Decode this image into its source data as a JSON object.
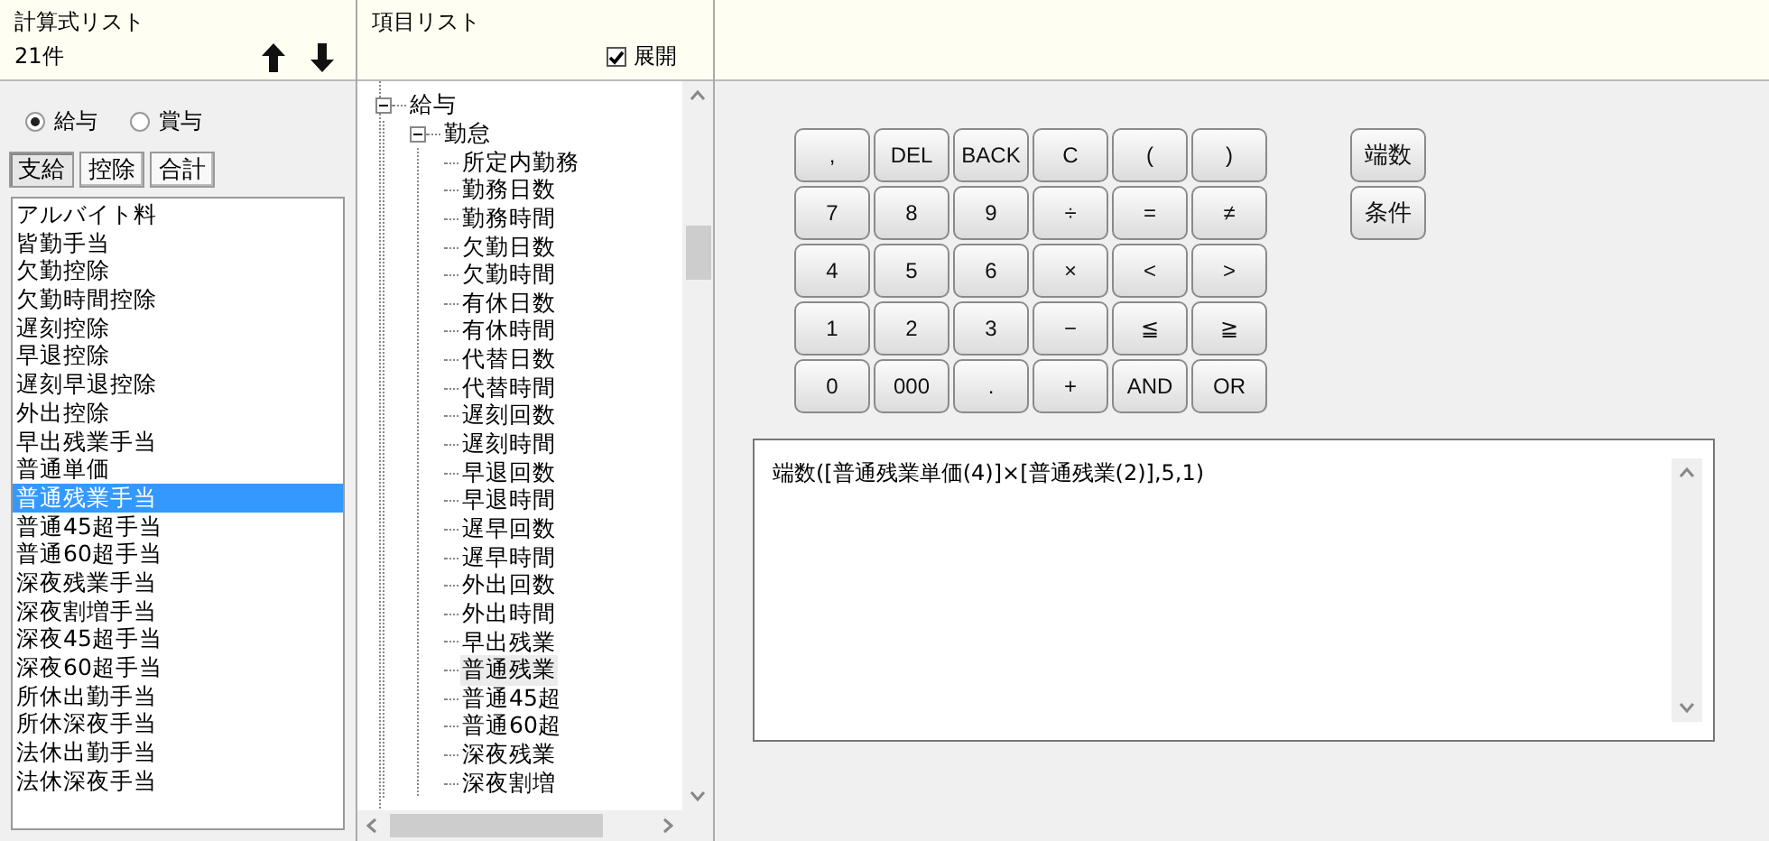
{
  "formula_list": {
    "title": "計算式リスト",
    "count": "21件",
    "radios": [
      {
        "label": "給与",
        "selected": true
      },
      {
        "label": "賞与",
        "selected": false
      }
    ],
    "tabs": [
      {
        "label": "支給",
        "selected": true
      },
      {
        "label": "控除",
        "selected": false
      },
      {
        "label": "合計",
        "selected": false
      }
    ],
    "items": [
      {
        "label": "アルバイト料",
        "selected": false
      },
      {
        "label": "皆勤手当",
        "selected": false
      },
      {
        "label": "欠勤控除",
        "selected": false
      },
      {
        "label": "欠勤時間控除",
        "selected": false
      },
      {
        "label": "遅刻控除",
        "selected": false
      },
      {
        "label": "早退控除",
        "selected": false
      },
      {
        "label": "遅刻早退控除",
        "selected": false
      },
      {
        "label": "外出控除",
        "selected": false
      },
      {
        "label": "早出残業手当",
        "selected": false
      },
      {
        "label": "普通単価",
        "selected": false
      },
      {
        "label": "普通残業手当",
        "selected": true
      },
      {
        "label": "普通45超手当",
        "selected": false
      },
      {
        "label": "普通60超手当",
        "selected": false
      },
      {
        "label": "深夜残業手当",
        "selected": false
      },
      {
        "label": "深夜割増手当",
        "selected": false
      },
      {
        "label": "深夜45超手当",
        "selected": false
      },
      {
        "label": "深夜60超手当",
        "selected": false
      },
      {
        "label": "所休出勤手当",
        "selected": false
      },
      {
        "label": "所休深夜手当",
        "selected": false
      },
      {
        "label": "法休出勤手当",
        "selected": false
      },
      {
        "label": "法休深夜手当",
        "selected": false
      }
    ]
  },
  "item_list": {
    "title": "項目リスト",
    "expand": {
      "label": "展開",
      "checked": true
    },
    "tree": [
      {
        "label": "給与",
        "expanded": true,
        "selected": false,
        "children": [
          {
            "label": "勤怠",
            "expanded": true,
            "selected": false,
            "children": [
              {
                "label": "所定内勤務",
                "selected": false
              },
              {
                "label": "勤務日数",
                "selected": false
              },
              {
                "label": "勤務時間",
                "selected": false
              },
              {
                "label": "欠勤日数",
                "selected": false
              },
              {
                "label": "欠勤時間",
                "selected": false
              },
              {
                "label": "有休日数",
                "selected": false
              },
              {
                "label": "有休時間",
                "selected": false
              },
              {
                "label": "代替日数",
                "selected": false
              },
              {
                "label": "代替時間",
                "selected": false
              },
              {
                "label": "遅刻回数",
                "selected": false
              },
              {
                "label": "遅刻時間",
                "selected": false
              },
              {
                "label": "早退回数",
                "selected": false
              },
              {
                "label": "早退時間",
                "selected": false
              },
              {
                "label": "遅早回数",
                "selected": false
              },
              {
                "label": "遅早時間",
                "selected": false
              },
              {
                "label": "外出回数",
                "selected": false
              },
              {
                "label": "外出時間",
                "selected": false
              },
              {
                "label": "早出残業",
                "selected": false
              },
              {
                "label": "普通残業",
                "selected": true
              },
              {
                "label": "普通45超",
                "selected": false
              },
              {
                "label": "普通60超",
                "selected": false
              },
              {
                "label": "深夜残業",
                "selected": false
              },
              {
                "label": "深夜割増",
                "selected": false
              }
            ]
          }
        ]
      }
    ]
  },
  "keypad": [
    [
      ",",
      "DEL",
      "BACK",
      "C",
      "(",
      ")"
    ],
    [
      "7",
      "8",
      "9",
      "÷",
      "=",
      "≠"
    ],
    [
      "4",
      "5",
      "6",
      "×",
      "<",
      ">"
    ],
    [
      "1",
      "2",
      "3",
      "−",
      "≦",
      "≧"
    ],
    [
      "0",
      "000",
      ".",
      "+",
      "AND",
      "OR"
    ]
  ],
  "side_buttons": [
    "端数",
    "条件"
  ],
  "formula": "端数([普通残業単価(4)]×[普通残業(2)],5,1)"
}
